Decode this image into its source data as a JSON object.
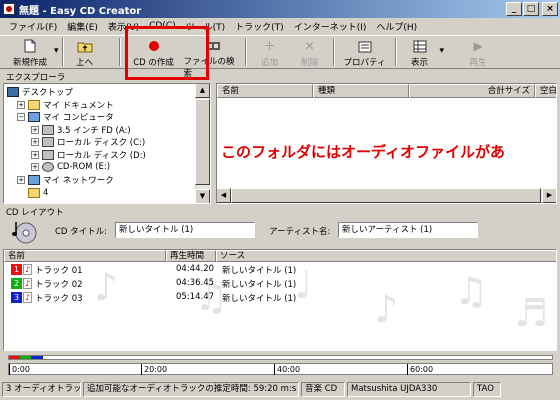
{
  "window": {
    "title": "無題 - Easy CD Creator",
    "buttons": {
      "minimize": "_",
      "maximize": "□",
      "close": "×"
    }
  },
  "menu": [
    "ファイル(F)",
    "編集(E)",
    "表示(V)",
    "CD(C)",
    "ツール(T)",
    "トラック(T)",
    "インターネット(I)",
    "ヘルプ(H)"
  ],
  "toolbar": {
    "new_project": "新規作成",
    "up": "上へ",
    "create_cd": "CD の作成",
    "find_files": "ファイルの検索",
    "add": "追加",
    "delete": "削除",
    "properties": "プロパティ",
    "view": "表示",
    "play": "再生",
    "dropdown_glyph": "▾",
    "highlight_color": "#e00000"
  },
  "explorer": {
    "label": "エクスプローラ",
    "tree": [
      {
        "label": "デスクトップ",
        "icon": "desktop-icon"
      },
      {
        "label": "マイ ドキュメント",
        "icon": "folder-icon"
      },
      {
        "label": "マイ コンピュータ",
        "icon": "computer-icon"
      },
      {
        "label": "3.5 インチ FD (A:)",
        "icon": "floppy-icon"
      },
      {
        "label": "ローカル ディスク (C:)",
        "icon": "drive-icon"
      },
      {
        "label": "ローカル ディスク (D:)",
        "icon": "drive-icon"
      },
      {
        "label": "CD-ROM (E:)",
        "icon": "cdrom-icon"
      },
      {
        "label": "マイ ネットワーク",
        "icon": "network-icon"
      },
      {
        "label": "4",
        "icon": "folder-icon"
      }
    ],
    "expanders": {
      "plus": "+",
      "minus": "−"
    }
  },
  "file_list": {
    "columns": [
      "名前",
      "種類",
      "合計サイズ",
      "空白"
    ],
    "empty_message": "このフォルダにはオーディオファイルがあ"
  },
  "cd_layout": {
    "label": "CD レイアウト",
    "title_label": "CD タイトル:",
    "title_value": "新しいタイトル (1)",
    "artist_label": "アーティスト名:",
    "artist_value": "新しいアーティスト (1)",
    "columns": [
      "名前",
      "再生時間",
      "ソース"
    ],
    "tracks": [
      {
        "number": "1",
        "name": "トラック 01",
        "time": "04:44.20",
        "source": "新しいタイトル (1)",
        "color": "#e81010"
      },
      {
        "number": "2",
        "name": "トラック 02",
        "time": "04:36.45",
        "source": "新しいタイトル (1)",
        "color": "#10b010"
      },
      {
        "number": "3",
        "name": "トラック 03",
        "time": "05:14.47",
        "source": "新しいタイトル (1)",
        "color": "#1020d0"
      }
    ]
  },
  "timeline": {
    "ticks": [
      "0:00",
      "20:00",
      "40:00",
      "60:00"
    ]
  },
  "status": {
    "track_count": "3 オーディオトラック",
    "remaining": "追加可能なオーディオトラックの推定時間: 59:20 m:s",
    "format": "音楽 CD",
    "drive": "Matsushita UJDA330",
    "mode": "TAO"
  }
}
